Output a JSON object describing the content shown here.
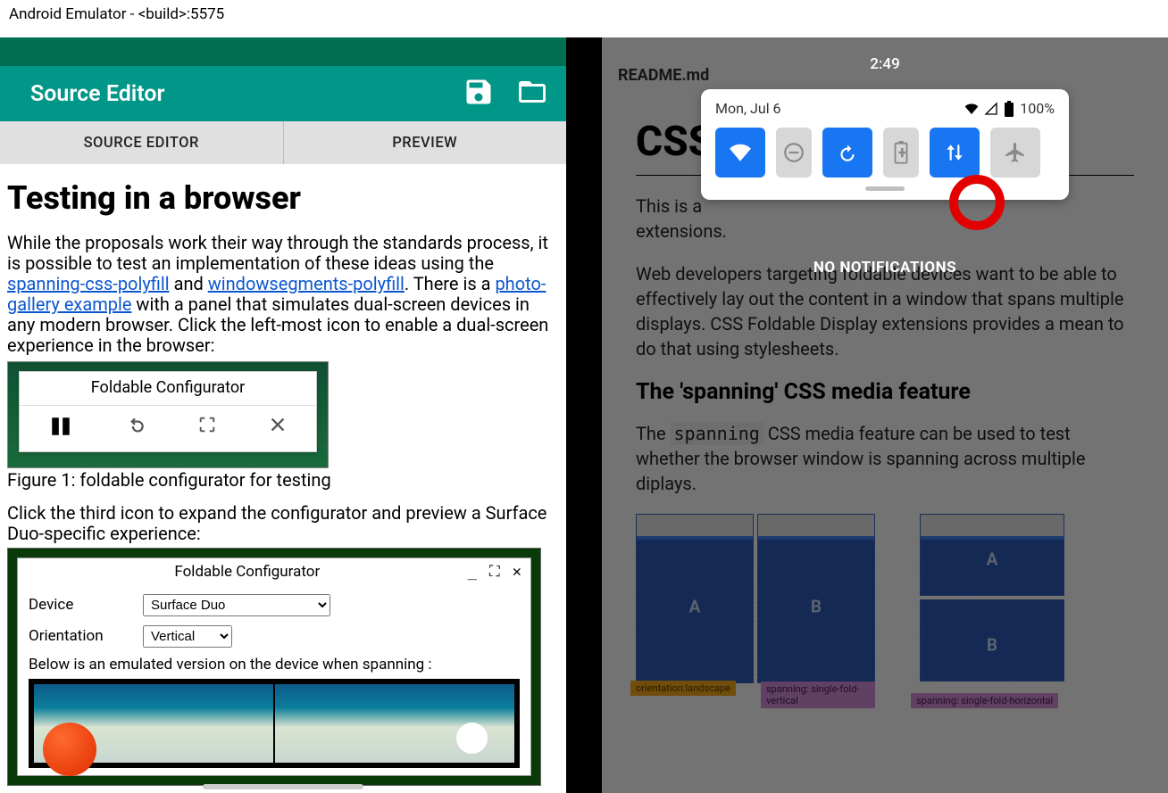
{
  "window_title": "Android Emulator - <build>:5575",
  "left_app": {
    "title": "Source Editor",
    "tabs": [
      "SOURCE EDITOR",
      "PREVIEW"
    ],
    "heading": "Testing in a browser",
    "p1a": "While the proposals work their way through the standards process, it is possible to test an implementation of these ideas using the ",
    "link1": "spanning-css-polyfill",
    "p1b": " and ",
    "link2": "windowsegments-polyfill",
    "p1c": ". There is a ",
    "link3": "photo-gallery example",
    "p1d": " with a panel that simulates dual-screen devices in any modern browser. Click the left-most icon to enable a dual-screen experience in the browser:",
    "fig1_title": "Foldable Configurator",
    "fig1_caption": "Figure 1: foldable configurator for testing",
    "p2": "Click the third icon to expand the configurator and preview a Surface Duo-specific experience:",
    "fig2_title": "Foldable Configurator",
    "fig2_device_label": "Device",
    "fig2_device_value": "Surface Duo",
    "fig2_orient_label": "Orientation",
    "fig2_orient_value": "Vertical",
    "fig2_below": "Below is an emulated version on the device when spanning :"
  },
  "right_app": {
    "filename": "README.md",
    "h1": "CSS",
    "p1": "This is a",
    "p1b": "extensions.",
    "p2": "Web developers targeting foldable devices want to be able to effectively lay out the content in a window that spans multiple displays. CSS Foldable Display extensions provides a mean to do that using stylesheets.",
    "h2": "The 'spanning' CSS media feature",
    "p3a": "The ",
    "p3_code": "spanning",
    "p3b": " CSS media feature can be used to test whether the browser window is spanning across multiple diplays.",
    "diag_labels": {
      "a": "A",
      "b": "B"
    },
    "tags": {
      "orientation": "orientation:landscape",
      "vertical": "spanning: single-fold-vertical",
      "horizontal": "spanning: single-fold-horizontal"
    }
  },
  "shade": {
    "time": "2:49",
    "date": "Mon, Jul 6",
    "battery": "100%",
    "no_notif": "NO NOTIFICATIONS"
  }
}
